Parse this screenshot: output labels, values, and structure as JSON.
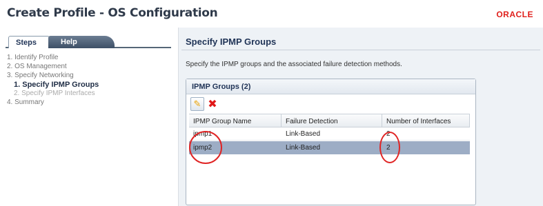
{
  "header": {
    "title": "Create Profile - OS Configuration",
    "logo": "ORACLE"
  },
  "left_tabs": {
    "steps": "Steps",
    "help": "Help"
  },
  "steps": [
    {
      "label": "1.  Identify Profile",
      "state": "done"
    },
    {
      "label": "2.  OS Management",
      "state": "done"
    },
    {
      "label": "3.  Specify Networking",
      "state": "done"
    },
    {
      "label": "1.  Specify IPMP Groups",
      "state": "current"
    },
    {
      "label": "2.  Specify IPMP Interfaces",
      "state": "future"
    },
    {
      "label": "4.  Summary",
      "state": "done"
    }
  ],
  "main": {
    "title": "Specify IPMP Groups",
    "description": "Specify the IPMP groups and the associated failure detection methods.",
    "panel": {
      "title": "IPMP Groups (2)",
      "toolbar": {
        "add_icon": "add-icon",
        "delete_icon": "delete-icon"
      },
      "columns": [
        "IPMP Group Name",
        "Failure Detection",
        "Number of Interfaces"
      ],
      "rows": [
        {
          "name": "ipmp1",
          "detection": "Link-Based",
          "count": "2",
          "selected": false
        },
        {
          "name": "ipmp2",
          "detection": "Link-Based",
          "count": "2",
          "selected": true
        }
      ]
    }
  },
  "colors": {
    "title": "#2f3a4a",
    "brand": "#e0201c",
    "selected_row": "#9dadc5",
    "annotation": "#e02424"
  }
}
